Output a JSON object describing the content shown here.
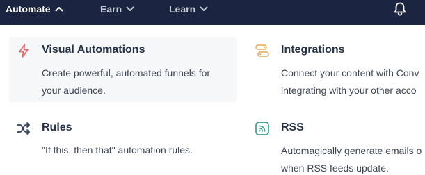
{
  "nav": {
    "automate_label": "Automate",
    "earn_label": "Earn",
    "learn_label": "Learn"
  },
  "menu": {
    "visual_automations": {
      "title": "Visual Automations",
      "desc_line1": "Create powerful, automated funnels for",
      "desc_line2": "your audience."
    },
    "integrations": {
      "title": "Integrations",
      "desc_line1": "Connect your content with Conv",
      "desc_line2": "integrating with your other acco"
    },
    "rules": {
      "title": "Rules",
      "desc_line1": "\"If this, then that\" automation rules."
    },
    "rss": {
      "title": "RSS",
      "desc_line1": "Automagically generate emails o",
      "desc_line2": "when RSS feeds update."
    }
  },
  "colors": {
    "nav_background": "#1b2541",
    "highlight_background": "#f6f7f8",
    "title_text": "#263246",
    "lightning_icon": "#e8676b",
    "integrations_icon": "#eab267",
    "shuffle_icon": "#2f3e5b",
    "rss_icon": "#3f9d86"
  }
}
